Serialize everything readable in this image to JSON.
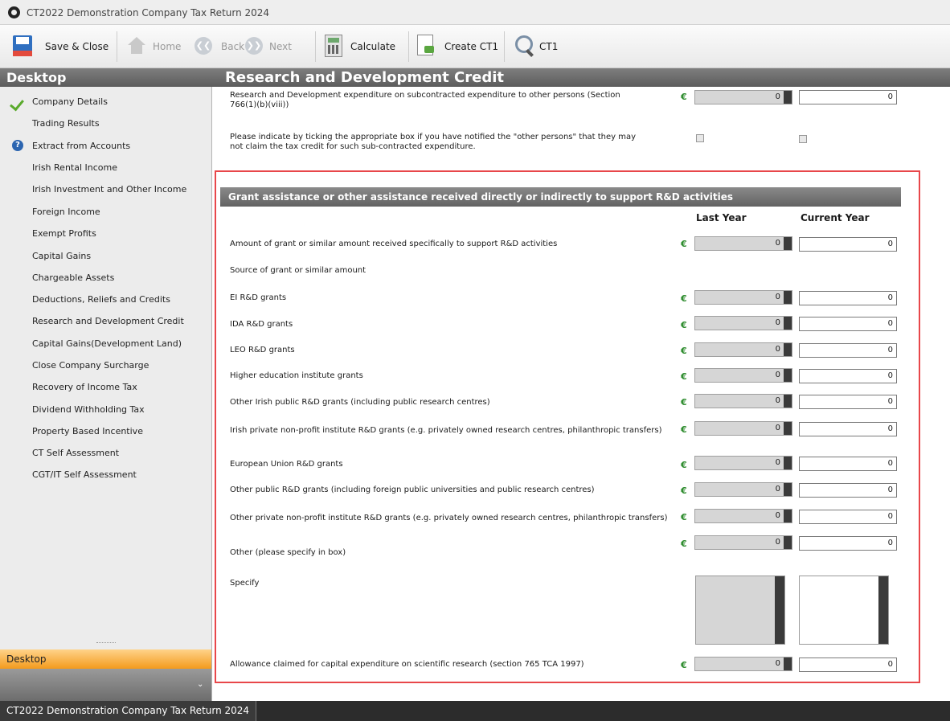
{
  "window": {
    "title": "CT2022 Demonstration Company Tax Return 2024"
  },
  "toolbar": {
    "save_close": "Save & Close",
    "home": "Home",
    "back": "Back",
    "next": "Next",
    "calculate": "Calculate",
    "create_ct1": "Create CT1",
    "ct1": "CT1"
  },
  "sidebar": {
    "title": "Desktop",
    "items": [
      {
        "label": "Company Details",
        "status": "complete"
      },
      {
        "label": "Trading Results"
      },
      {
        "label": "Extract from Accounts",
        "status": "info"
      },
      {
        "label": "Irish Rental Income"
      },
      {
        "label": "Irish Investment and Other Income"
      },
      {
        "label": "Foreign Income"
      },
      {
        "label": "Exempt Profits"
      },
      {
        "label": "Capital Gains"
      },
      {
        "label": "Chargeable Assets"
      },
      {
        "label": "Deductions, Reliefs and Credits"
      },
      {
        "label": "Research and Development Credit"
      },
      {
        "label": "Capital Gains(Development Land)"
      },
      {
        "label": "Close Company Surcharge"
      },
      {
        "label": "Recovery of Income Tax"
      },
      {
        "label": "Dividend Withholding Tax"
      },
      {
        "label": "Property Based Incentive"
      },
      {
        "label": "CT Self Assessment"
      },
      {
        "label": "CGT/IT Self Assessment"
      }
    ],
    "active_panel": "Desktop"
  },
  "page": {
    "title": "Research and Development Credit",
    "top_rows": {
      "subcontracted_label": "Research and Development expenditure on subcontracted expenditure to other persons (Section 766(1)(b)(viii))",
      "subcontracted_last": "0",
      "subcontracted_current": "0",
      "notify_label": "Please indicate by ticking the appropriate box if you have notified the \"other persons\" that they may not claim the tax credit for such sub-contracted expenditure."
    },
    "section": {
      "title": "Grant assistance or other assistance received directly or indirectly to support R&D activities",
      "col_last": "Last Year",
      "col_current": "Current Year",
      "currency": "€",
      "grant_amount": {
        "label": "Amount of grant or similar amount received specifically to support R&D activities",
        "last": "0",
        "current": "0"
      },
      "source_label": "Source of grant or similar amount",
      "rows": [
        {
          "label": "EI R&D grants",
          "last": "0",
          "current": "0"
        },
        {
          "label": "IDA R&D grants",
          "last": "0",
          "current": "0"
        },
        {
          "label": "LEO R&D grants",
          "last": "0",
          "current": "0"
        },
        {
          "label": "Higher education institute grants",
          "last": "0",
          "current": "0"
        },
        {
          "label": "Other Irish public R&D grants (including public research centres)",
          "last": "0",
          "current": "0"
        },
        {
          "label": "Irish private non-profit institute R&D grants (e.g. privately owned research centres, philanthropic transfers)",
          "last": "0",
          "current": "0"
        },
        {
          "label": "European Union R&D grants",
          "last": "0",
          "current": "0"
        },
        {
          "label": "Other public R&D grants (including foreign public universities and public research centres)",
          "last": "0",
          "current": "0"
        },
        {
          "label": "Other private non-profit institute R&D grants (e.g. privately owned research centres, philanthropic transfers)",
          "last": "0",
          "current": "0"
        },
        {
          "label": "Other (please specify in box)",
          "last": "0",
          "current": "0"
        }
      ],
      "specify_label": "Specify",
      "allowance": {
        "label": "Allowance claimed for capital expenditure on scientific research (section 765 TCA 1997)",
        "last": "0",
        "current": "0"
      }
    }
  },
  "statusbar": {
    "text": "CT2022 Demonstration Company Tax Return 2024"
  },
  "colors": {
    "accent": "#f39a1d",
    "highlight": "#e8474a",
    "euro": "#2a8a2a",
    "header": "#6b6b6b"
  }
}
